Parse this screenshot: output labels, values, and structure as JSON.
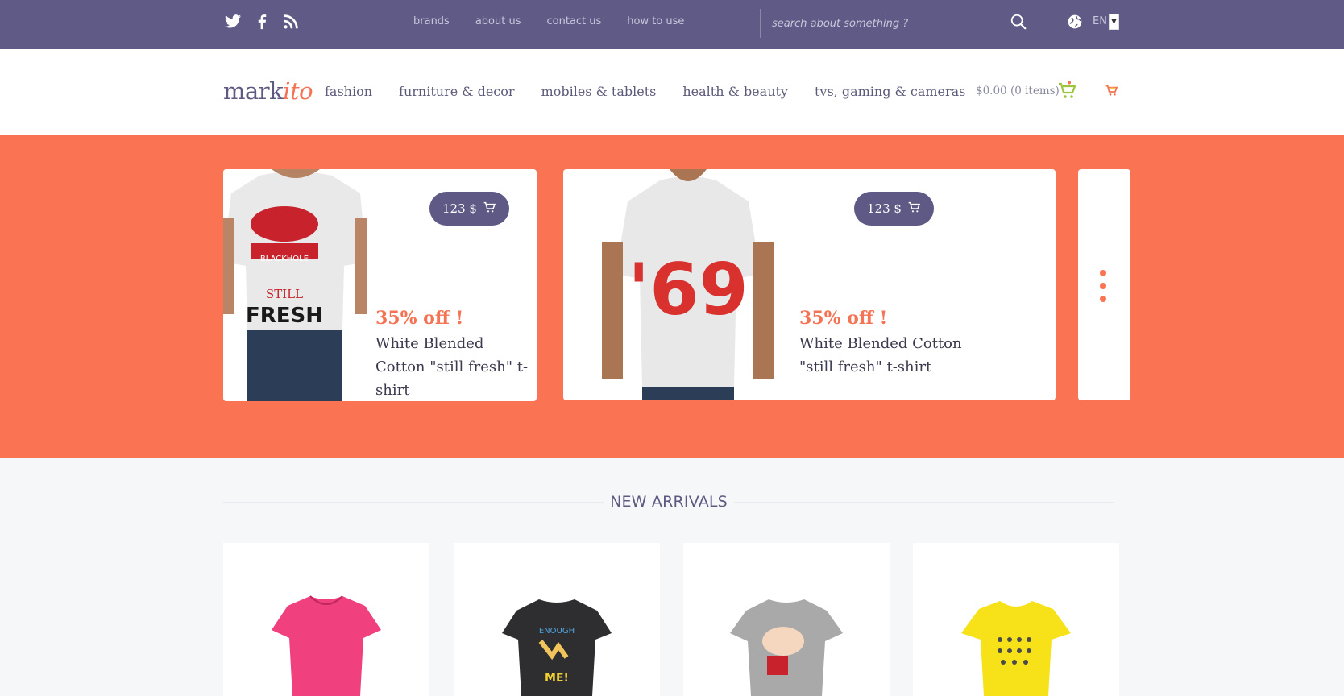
{
  "topbar": {
    "links": [
      "brands",
      "about us",
      "contact us",
      "how to use"
    ],
    "search_placeholder": "search about something ?",
    "language": "EN"
  },
  "mainnav": {
    "logo_main": "mark",
    "logo_accent": "ito",
    "links": [
      "fashion",
      "furniture & decor",
      "mobiles & tablets",
      "health & beauty",
      "tvs, gaming & cameras"
    ],
    "cart_summary": "$0.00 (0 items)"
  },
  "hero": {
    "slides": [
      {
        "price": "123 $",
        "discount": "35% off !",
        "title": "White Blended Cotton \"still fresh\" t-shirt"
      },
      {
        "price": "123 $",
        "discount": "35% off !",
        "title": "White Blended Cotton \"still fresh\" t-shirt"
      }
    ]
  },
  "new_arrivals": {
    "title": "NEW ARRIVALS"
  },
  "colors": {
    "topbar": "#605a86",
    "accent": "#fa7453",
    "pill": "#5e5a85",
    "cart_green": "#9bc53d"
  }
}
